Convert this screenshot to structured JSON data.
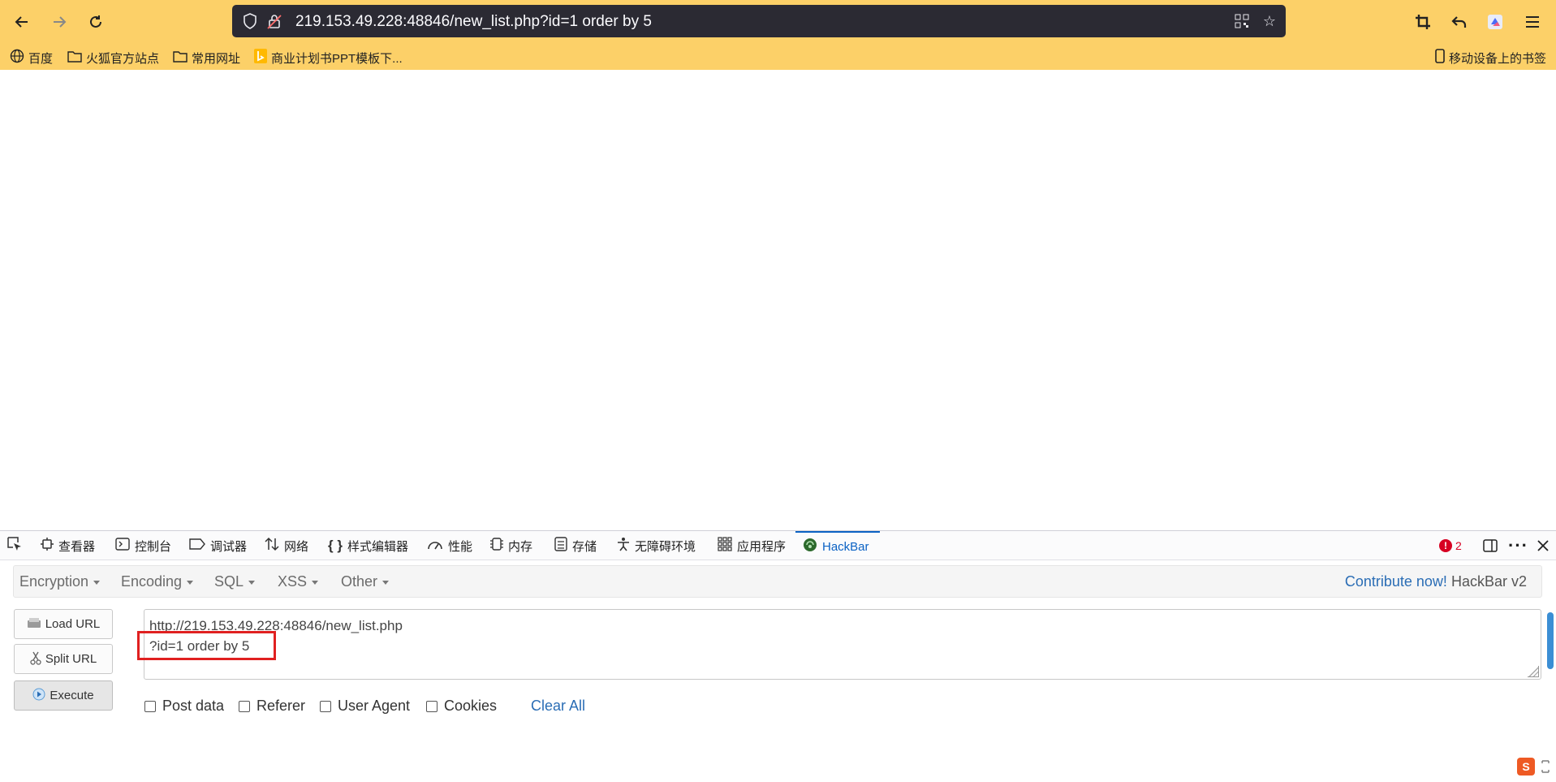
{
  "browser": {
    "url": "219.153.49.228:48846/new_list.php?id=1 order by 5",
    "bookmarks": [
      {
        "label": "百度",
        "icon": "globe-icon"
      },
      {
        "label": "火狐官方站点",
        "icon": "folder-icon"
      },
      {
        "label": "常用网址",
        "icon": "folder-icon"
      },
      {
        "label": "商业计划书PPT模板下...",
        "icon": "bing-icon"
      }
    ],
    "mobile_bookmarks": "移动设备上的书签"
  },
  "devtools": {
    "tabs": [
      {
        "label": "查看器",
        "icon": "inspector-icon"
      },
      {
        "label": "控制台",
        "icon": "console-icon"
      },
      {
        "label": "调试器",
        "icon": "debugger-icon"
      },
      {
        "label": "网络",
        "icon": "network-icon"
      },
      {
        "label": "样式编辑器",
        "icon": "style-editor-icon"
      },
      {
        "label": "性能",
        "icon": "performance-icon"
      },
      {
        "label": "内存",
        "icon": "memory-icon"
      },
      {
        "label": "存储",
        "icon": "storage-icon"
      },
      {
        "label": "无障碍环境",
        "icon": "accessibility-icon"
      },
      {
        "label": "应用程序",
        "icon": "application-icon"
      },
      {
        "label": "HackBar",
        "icon": "hackbar-icon"
      }
    ],
    "active_tab": "HackBar",
    "error_count": "2"
  },
  "hackbar": {
    "menu": [
      "Encryption",
      "Encoding",
      "SQL",
      "XSS",
      "Other"
    ],
    "contribute_link": "Contribute now!",
    "version": "HackBar v2",
    "buttons": {
      "load_url": "Load URL",
      "split_url": "Split URL",
      "execute": "Execute"
    },
    "url_line1": "http://219.153.49.228:48846/new_list.php",
    "url_line2": "?id=1 order by 5",
    "options": [
      "Post data",
      "Referer",
      "User Agent",
      "Cookies"
    ],
    "clear_all": "Clear All"
  },
  "colors": {
    "toolbar_bg": "#fcd068",
    "urlbar_bg": "#2b2a33",
    "highlight_box": "#e02020",
    "link": "#2a6db5",
    "active_tab": "#0b62c4"
  }
}
